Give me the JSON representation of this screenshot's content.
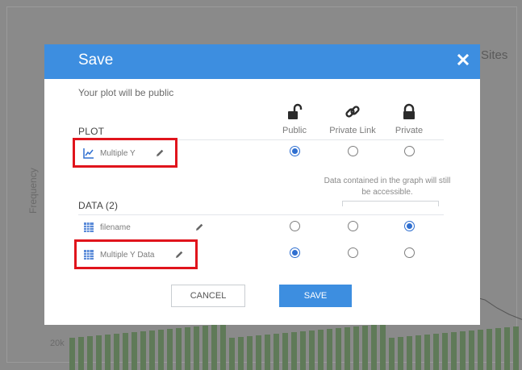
{
  "background": {
    "chart_title_fragment": "Sites",
    "y_axis_label": "Frequency",
    "y_tick_label": "20k"
  },
  "modal": {
    "title": "Save",
    "subtitle": "Your plot will be public",
    "columns": [
      "Public",
      "Private Link",
      "Private"
    ],
    "plot_section": {
      "title": "PLOT",
      "items": [
        {
          "name": "Multiple Y",
          "selected": "Public"
        }
      ]
    },
    "data_section": {
      "title": "DATA (2)",
      "note": "Data contained in the graph will still be accessible.",
      "items": [
        {
          "name": "filename",
          "selected": "Private"
        },
        {
          "name": "Multiple Y Data",
          "selected": "Public"
        }
      ]
    },
    "buttons": {
      "cancel": "CANCEL",
      "save": "SAVE"
    }
  },
  "colors": {
    "header": "#3d8ee0",
    "accent": "#2f6fd0",
    "highlight": "#e0141c"
  }
}
